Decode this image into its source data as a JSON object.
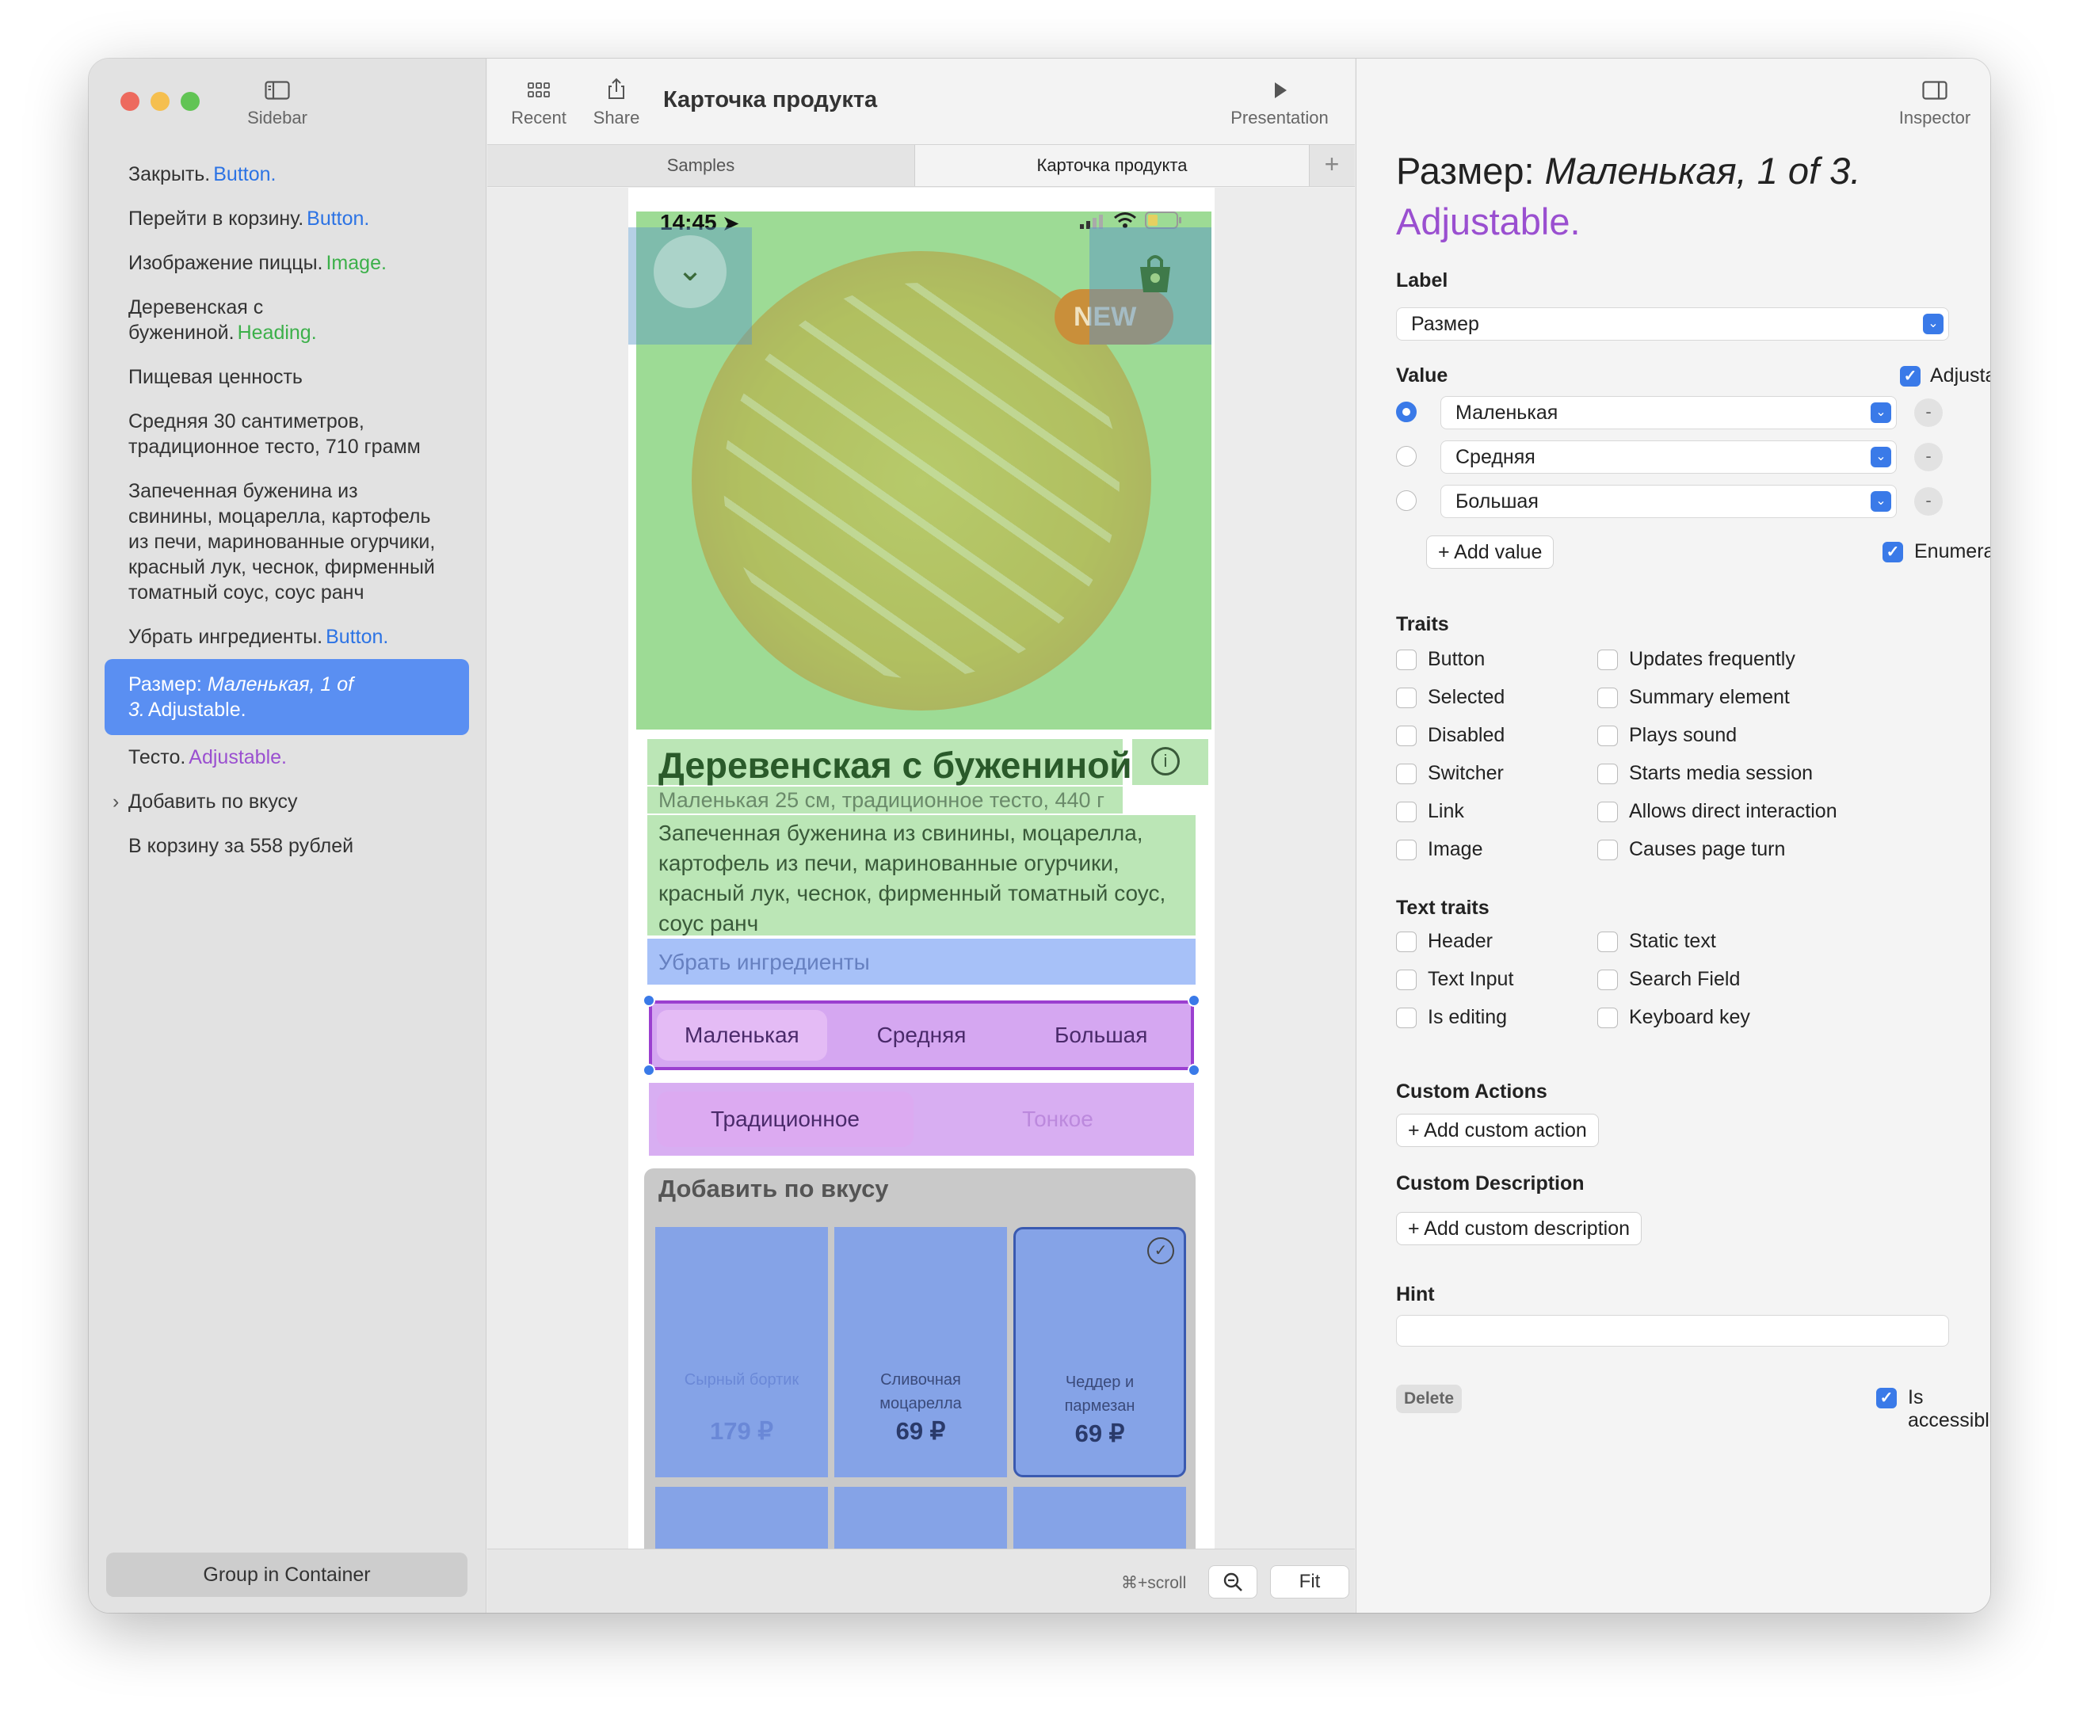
{
  "window": {
    "traffic_lights": {
      "close": "#ed6a5e",
      "minimize": "#f5bf4f",
      "zoom": "#61c454"
    }
  },
  "sidebar": {
    "toggle_label": "Sidebar",
    "items": [
      {
        "text": "Закрыть.",
        "role": "Button.",
        "role_kind": "button"
      },
      {
        "text": "Перейти в корзину.",
        "role": "Button.",
        "role_kind": "button"
      },
      {
        "text": "Изображение пиццы.",
        "role": "Image.",
        "role_kind": "image"
      },
      {
        "text": "Деревенская с бужениной.",
        "role": "Heading.",
        "role_kind": "image"
      },
      {
        "text": "Пищевая ценность",
        "role": "",
        "role_kind": ""
      },
      {
        "text": "Средняя 30 сантиметров, традиционное тесто, 710 грамм",
        "role": "",
        "role_kind": ""
      },
      {
        "text": "Запеченная буженина из свинины, моцарелла, картофель из печи, маринованные огурчики, красный лук, чеснок, фирменный томатный соус, соус ранч",
        "role": "",
        "role_kind": ""
      },
      {
        "text": "Убрать ингредиенты.",
        "role": "Button.",
        "role_kind": "button"
      },
      {
        "text": "Размер: ",
        "value": "Маленькая, 1 of 3.",
        "role": "Adjustable.",
        "role_kind": "adjustable",
        "selected": true
      },
      {
        "text": "Тесто.",
        "role": "Adjustable.",
        "role_kind": "adjustable"
      },
      {
        "text": "Добавить по вкусу",
        "role": "",
        "role_kind": "",
        "disclosure": true
      },
      {
        "text": "В корзину за 558 рублей",
        "role": "",
        "role_kind": ""
      }
    ],
    "group_button": "Group in Container"
  },
  "toolbar": {
    "recent_label": "Recent",
    "share_label": "Share",
    "doc_title": "Карточка продукта",
    "presentation_label": "Presentation",
    "inspector_label": "Inspector"
  },
  "tabs": [
    {
      "label": "Samples",
      "active": false
    },
    {
      "label": "Карточка продукта",
      "active": true
    }
  ],
  "phone": {
    "time": "14:45",
    "badge": "NEW",
    "product_title": "Деревенская с бужениной",
    "product_subtitle": "Маленькая 25 см, традиционное тесто, 440 г",
    "description": "Запеченная буженина из свинины, моцарелла, картофель из печи, маринованные огурчики, красный лук, чеснок, фирменный томатный соус, соус ранч",
    "remove_ingredients": "Убрать ингредиенты",
    "sizes": [
      "Маленькая",
      "Средняя",
      "Большая"
    ],
    "selected_size": "Маленькая",
    "doughs": [
      "Традиционное",
      "Тонкое"
    ],
    "selected_dough": "Традиционное",
    "addons_title": "Добавить по вкусу",
    "addons": [
      {
        "name": "Сырный бортик",
        "price": "179 ₽",
        "available": false
      },
      {
        "name": "Сливочная моцарелла",
        "price": "69 ₽",
        "available": true
      },
      {
        "name": "Чеддер и пармезан",
        "price": "69 ₽",
        "available": true,
        "selected": true
      }
    ]
  },
  "bottombar": {
    "hint": "⌘+scroll",
    "fit_label": "Fit"
  },
  "inspector": {
    "heading_name": "Размер: ",
    "heading_value": "Маленькая, 1 of 3.",
    "heading_trait": "Adjustable.",
    "label_section": "Label",
    "label_value": "Размер",
    "value_section": "Value",
    "adjustable_label": "Adjustable",
    "adjustable_checked": true,
    "values": [
      "Маленькая",
      "Средняя",
      "Большая"
    ],
    "selected_value_index": 0,
    "add_value": "+ Add value",
    "enumerated_label": "Enumerated",
    "enumerated_checked": true,
    "traits_section": "Traits",
    "traits_left": [
      "Button",
      "Selected",
      "Disabled",
      "Switcher",
      "Link",
      "Image"
    ],
    "traits_right": [
      "Updates frequently",
      "Summary element",
      "Plays sound",
      "Starts media session",
      "Allows direct interaction",
      "Causes page turn"
    ],
    "text_traits_section": "Text traits",
    "text_traits_left": [
      "Header",
      "Text Input",
      "Is editing"
    ],
    "text_traits_right": [
      "Static text",
      "Search Field",
      "Keyboard key"
    ],
    "custom_actions_section": "Custom Actions",
    "add_custom_action": "+ Add custom action",
    "custom_description_section": "Custom Description",
    "add_custom_description": "+ Add custom description",
    "hint_section": "Hint",
    "hint_value": "",
    "delete_label": "Delete",
    "is_accessible_label": "Is accessible",
    "is_accessible_checked": true
  },
  "colors": {
    "accent": "#3a7ae8",
    "selection": "#5a8ff2",
    "button_role": "#2c73e4",
    "image_role": "#3cb04a",
    "adjustable_role": "#9a4fd0"
  }
}
